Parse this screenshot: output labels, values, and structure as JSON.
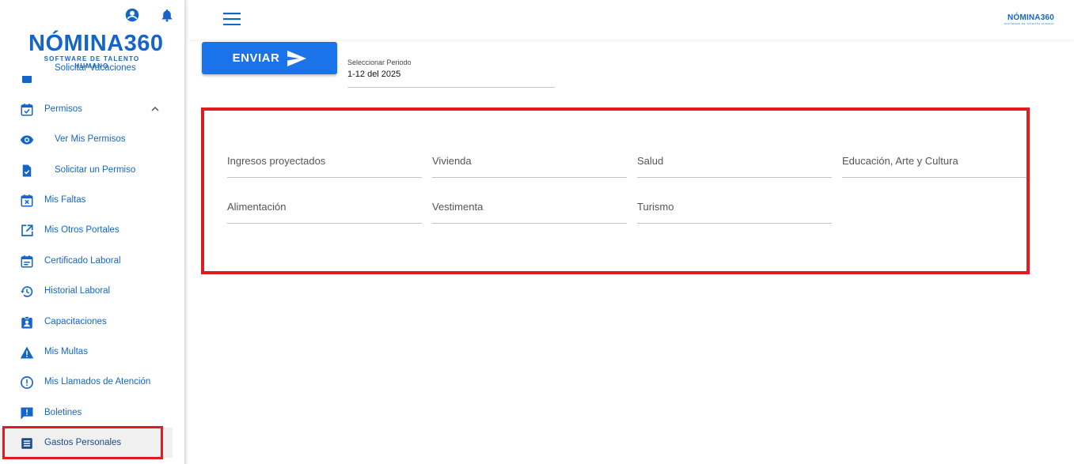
{
  "header": {
    "brand_main": "NÓMINA360",
    "brand_sub": "SOFTWARE DE TALENTO HUMANO"
  },
  "sidebar": {
    "logo_main": "NÓMINA360",
    "logo_sub": "SOFTWARE DE TALENTO HUMANO",
    "items": [
      {
        "label": "Solicitar Vacaciones",
        "icon": "calendar-download-icon"
      },
      {
        "label": "Permisos",
        "icon": "calendar-check-icon"
      },
      {
        "label": "Ver Mis Permisos",
        "icon": "eye-icon"
      },
      {
        "label": "Solicitar un Permiso",
        "icon": "document-check-icon"
      },
      {
        "label": "Mis Faltas",
        "icon": "calendar-x-icon"
      },
      {
        "label": "Mis Otros Portales",
        "icon": "external-link-icon"
      },
      {
        "label": "Certificado Laboral",
        "icon": "calendar-note-icon"
      },
      {
        "label": "Historial Laboral",
        "icon": "history-icon"
      },
      {
        "label": "Capacitaciones",
        "icon": "badge-icon"
      },
      {
        "label": "Mis Multas",
        "icon": "warning-icon"
      },
      {
        "label": "Mis Llamados de Atención",
        "icon": "alert-circle-icon"
      },
      {
        "label": "Boletines",
        "icon": "announcement-icon"
      },
      {
        "label": "Gastos Personales",
        "icon": "list-alt-icon"
      }
    ]
  },
  "toolbar": {
    "send_label": "ENVIAR"
  },
  "period": {
    "label": "Seleccionar Periodo",
    "value": "1-12 del 2025"
  },
  "form": {
    "fields": [
      {
        "label": "Ingresos proyectados"
      },
      {
        "label": "Vivienda"
      },
      {
        "label": "Salud"
      },
      {
        "label": "Educación, Arte y Cultura"
      },
      {
        "label": "Alimentación"
      },
      {
        "label": "Vestimenta"
      },
      {
        "label": "Turismo"
      }
    ]
  },
  "colors": {
    "brand": "#1465c7",
    "button": "#1a73e8",
    "highlight": "#e01b22"
  }
}
